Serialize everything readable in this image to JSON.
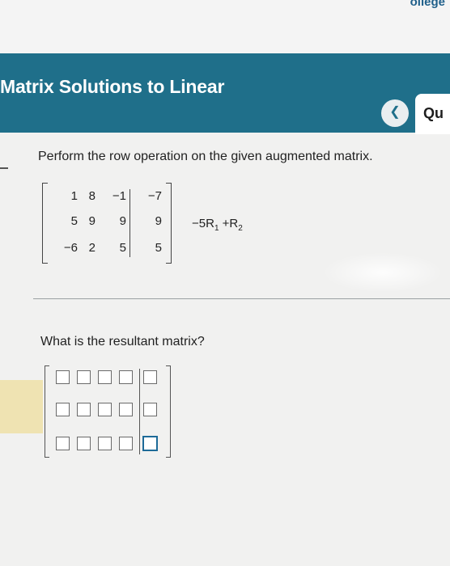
{
  "header": {
    "title": "Matrix Solutions to Linear",
    "prev_icon": "chevron-left-icon",
    "question_tab_label": "Qu",
    "brand_fragment": "ollege",
    "color": "#1f6f8a"
  },
  "problem": {
    "prompt": "Perform the row operation on the given augmented matrix.",
    "matrix": [
      [
        "1",
        "8",
        "−1",
        "−7"
      ],
      [
        "5",
        "9",
        "9",
        "9"
      ],
      [
        "−6",
        "2",
        "5",
        "5"
      ]
    ],
    "operation": {
      "prefix": "−5R",
      "sub1": "1",
      "middle": " +R",
      "sub2": "2"
    }
  },
  "answer": {
    "question": "What is the resultant matrix?",
    "rows": 3,
    "cols": 4,
    "focused_cell": "row3-col4"
  }
}
